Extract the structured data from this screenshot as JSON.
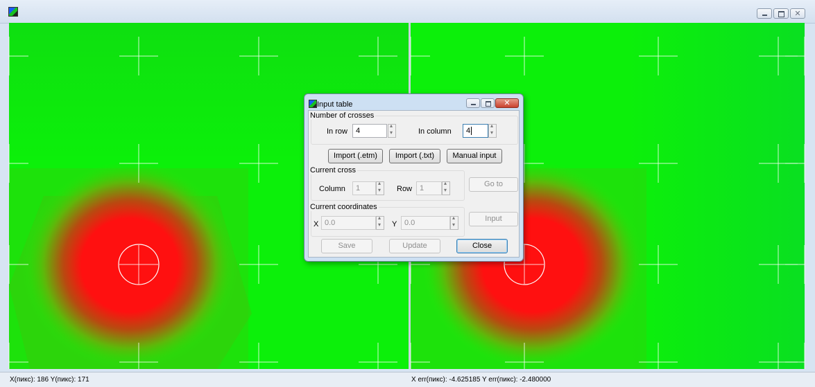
{
  "window": {
    "title": "",
    "buttons": [
      "minimize",
      "maximize",
      "close"
    ]
  },
  "colors": {
    "background": "#08f508",
    "hotspot": "#ff1010",
    "crosshair": "#ffffff"
  },
  "status": {
    "left": "X(пикс): 186   Y(пикс): 171",
    "right": "X err(пикс): -4.625185   Y err(пикс): -2.480000"
  },
  "dialog": {
    "title": "Input table",
    "close_glyph": "✕",
    "number_of_crosses": {
      "label": "Number of crosses",
      "in_row_label": "In row",
      "in_row_value": "4",
      "in_column_label": "In column",
      "in_column_value": "4"
    },
    "import_etm": "Import (.etm)",
    "import_txt": "Import (.txt)",
    "manual_input": "Manual input",
    "current_cross": {
      "label": "Current cross",
      "column_label": "Column",
      "column_value": "1",
      "row_label": "Row",
      "row_value": "1",
      "go_to": "Go to"
    },
    "current_coordinates": {
      "label": "Current coordinates",
      "x_label": "X",
      "x_value": "0.0",
      "y_label": "Y",
      "y_value": "0.0",
      "input": "Input"
    },
    "save": "Save",
    "update": "Update",
    "close": "Close"
  },
  "window_close_glyph": "✕"
}
